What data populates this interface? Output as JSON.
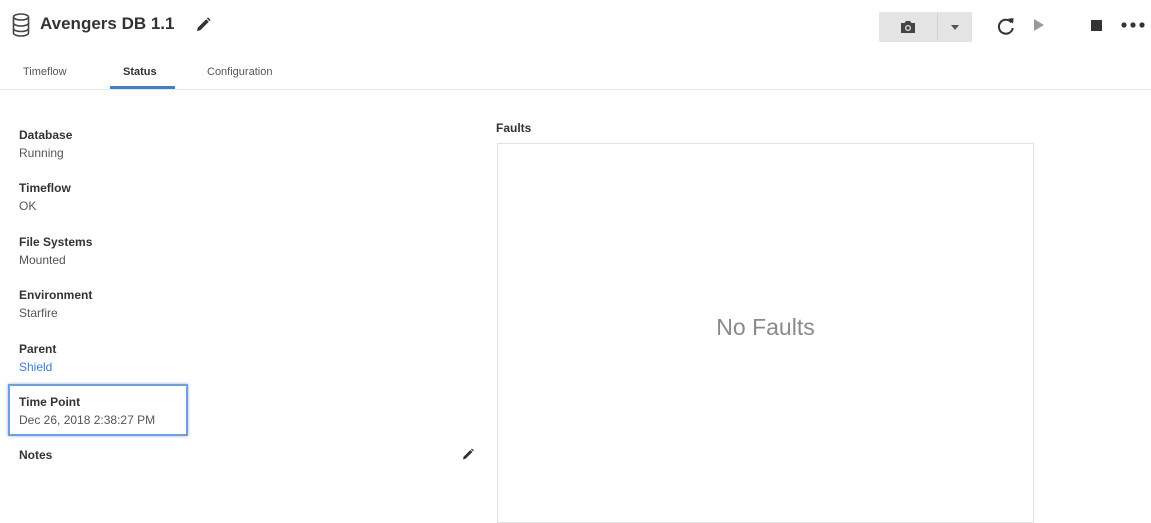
{
  "header": {
    "title": "Avengers DB 1.1",
    "icons": [
      "database-icon",
      "edit-pencil-icon"
    ]
  },
  "toolbar": {
    "icons": [
      "camera-icon",
      "caret-down-icon",
      "refresh-icon",
      "play-icon",
      "stop-icon",
      "more-options-icon"
    ],
    "button_bg": "#e4e4e4"
  },
  "tabs": [
    {
      "label": "Timeflow",
      "active": false
    },
    {
      "label": "Status",
      "active": true
    },
    {
      "label": "Configuration",
      "active": false
    }
  ],
  "status": {
    "fields": [
      {
        "label": "Database",
        "value": "Running"
      },
      {
        "label": "Timeflow",
        "value": "OK"
      },
      {
        "label": "File Systems",
        "value": "Mounted"
      },
      {
        "label": "Environment",
        "value": "Starfire"
      },
      {
        "label": "Parent",
        "value": "Shield"
      },
      {
        "label": "Time Point",
        "value": "Dec 26, 2018 2:38:27 PM"
      }
    ],
    "notes_label": "Notes"
  },
  "faults": {
    "label": "Faults",
    "empty_message": "No Faults"
  },
  "colors": {
    "accent": "#3f7fc4",
    "link": "#3b7dd8",
    "highlight_border": "#6f9fd8"
  }
}
